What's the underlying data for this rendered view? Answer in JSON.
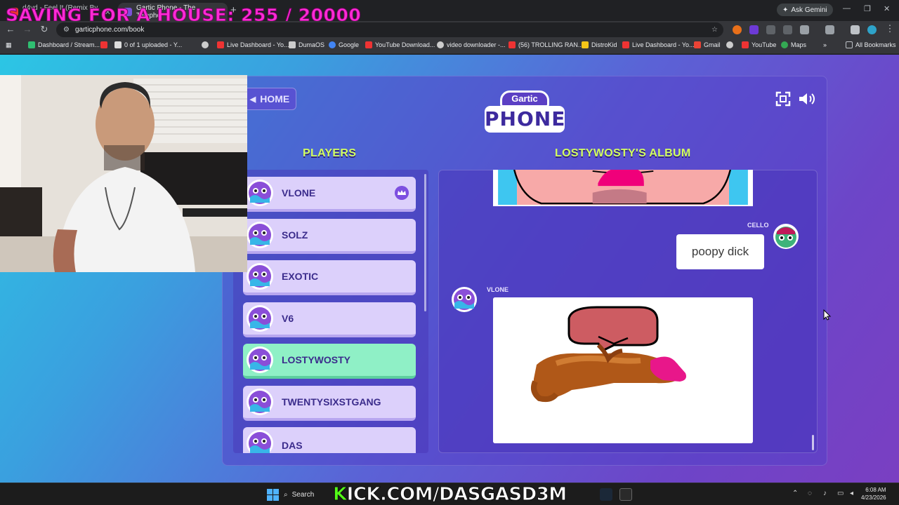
{
  "overlay": {
    "goal_text": "SAVING FOR A HOUSE: 255 / 20000"
  },
  "browser": {
    "tabs": [
      {
        "label": "d4vd - Feel It (Remix By L",
        "active": false
      },
      {
        "label": "Gartic Phone - The Telepho",
        "active": true
      }
    ],
    "ask_gemini": "Ask Gemini",
    "url": "garticphone.com/book",
    "bookmarks": [
      "Dashboard / Stream...",
      "0 of 1 uploaded - Y...",
      "Live Dashboard - Yo...",
      "DumaOS",
      "Google",
      "YouTube Download...",
      "video downloader -...",
      "(56) TROLLING RAN...",
      "DistroKid",
      "Live Dashboard - Yo...",
      "Gmail",
      "YouTube",
      "Maps"
    ],
    "all_bookmarks": "All Bookmarks"
  },
  "game": {
    "home_label": "HOME",
    "logo_top": "Gartic",
    "logo_bottom": "PHONE",
    "players_title": "PLAYERS",
    "album_title": "LOSTYWOSTY'S ALBUM",
    "players": [
      {
        "name": "VLONE",
        "host": true,
        "active": false
      },
      {
        "name": "SOLZ",
        "host": false,
        "active": false
      },
      {
        "name": "EXOTIC",
        "host": false,
        "active": false
      },
      {
        "name": "V6",
        "host": false,
        "active": false
      },
      {
        "name": "LOSTYWOSTY",
        "host": false,
        "active": true
      },
      {
        "name": "TWENTYSIXSTGANG",
        "host": false,
        "active": false
      },
      {
        "name": "DAS",
        "host": false,
        "active": false
      }
    ],
    "album": {
      "guess_author": "CELLO",
      "guess_text": "poopy dick",
      "drawing_author": "VLONE"
    },
    "colors": {
      "accent_title": "#d2ff5f",
      "active_player": "#8ff0c6",
      "player_card": "#dcd0fb"
    }
  },
  "taskbar": {
    "search_label": "Search",
    "kick_prefix": "K",
    "kick_rest": "ICK.COM/DASGASD3M",
    "time": "6:08 AM",
    "date": "4/23/2026"
  }
}
